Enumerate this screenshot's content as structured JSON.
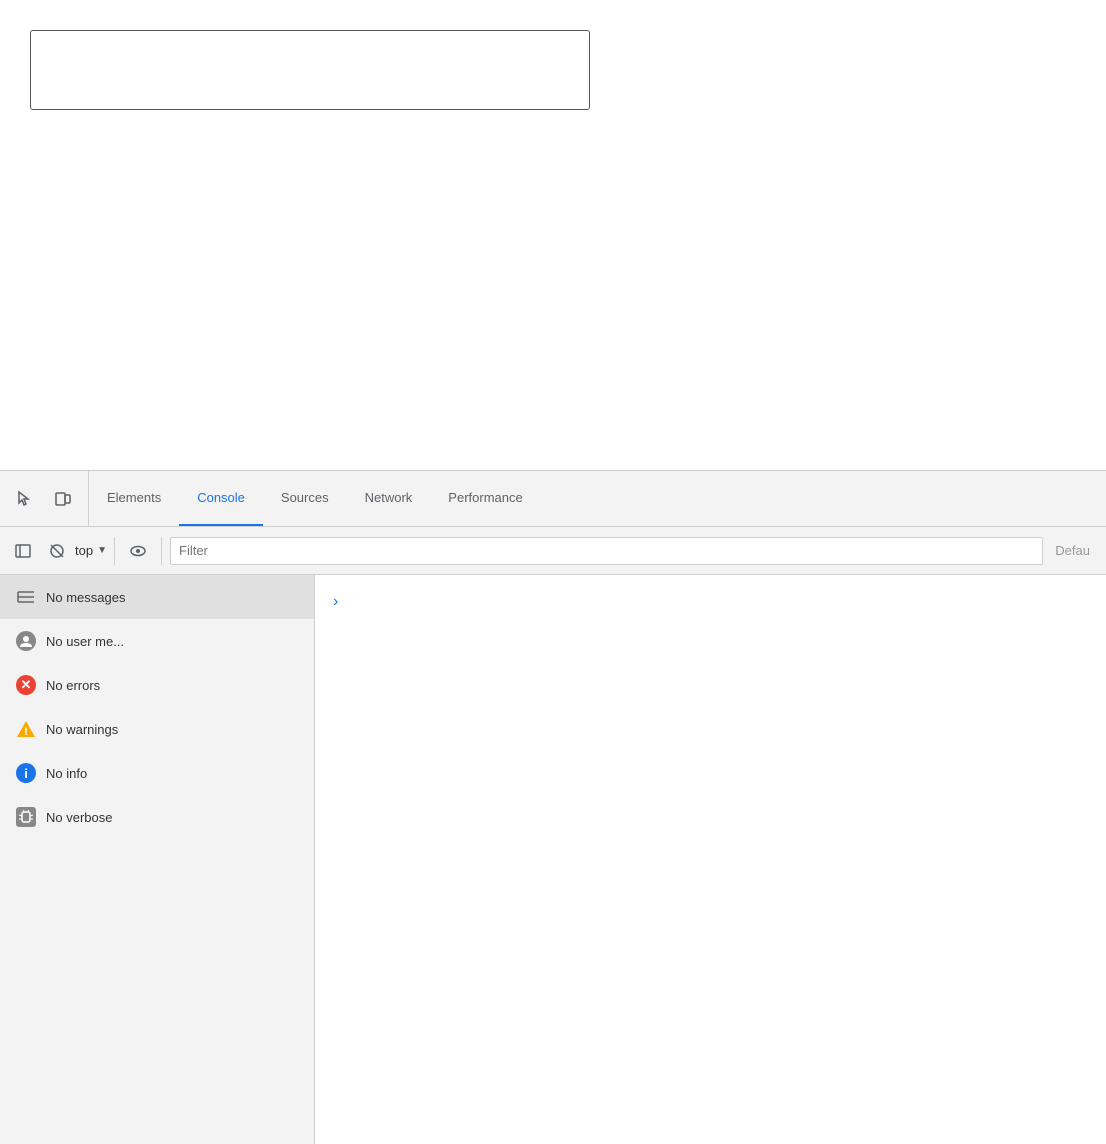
{
  "browser": {
    "content_height": 470
  },
  "devtools": {
    "toolbar": {
      "inspect_icon": "⬡",
      "toggle_icon": "⬜"
    },
    "tabs": [
      {
        "id": "elements",
        "label": "Elements",
        "active": false
      },
      {
        "id": "console",
        "label": "Console",
        "active": true
      },
      {
        "id": "sources",
        "label": "Sources",
        "active": false
      },
      {
        "id": "network",
        "label": "Network",
        "active": false
      },
      {
        "id": "performance",
        "label": "Performance",
        "active": false
      }
    ],
    "console_toolbar": {
      "top_label": "top",
      "filter_placeholder": "Filter",
      "default_label": "Defau"
    },
    "sidebar": {
      "items": [
        {
          "id": "messages",
          "label": "No messages",
          "icon_type": "messages",
          "selected": true
        },
        {
          "id": "user-messages",
          "label": "No user me...",
          "icon_type": "user",
          "selected": false
        },
        {
          "id": "errors",
          "label": "No errors",
          "icon_type": "error",
          "selected": false
        },
        {
          "id": "warnings",
          "label": "No warnings",
          "icon_type": "warning",
          "selected": false
        },
        {
          "id": "info",
          "label": "No info",
          "icon_type": "info",
          "selected": false
        },
        {
          "id": "verbose",
          "label": "No verbose",
          "icon_type": "verbose",
          "selected": false
        }
      ]
    },
    "main": {
      "chevron": "›"
    }
  }
}
